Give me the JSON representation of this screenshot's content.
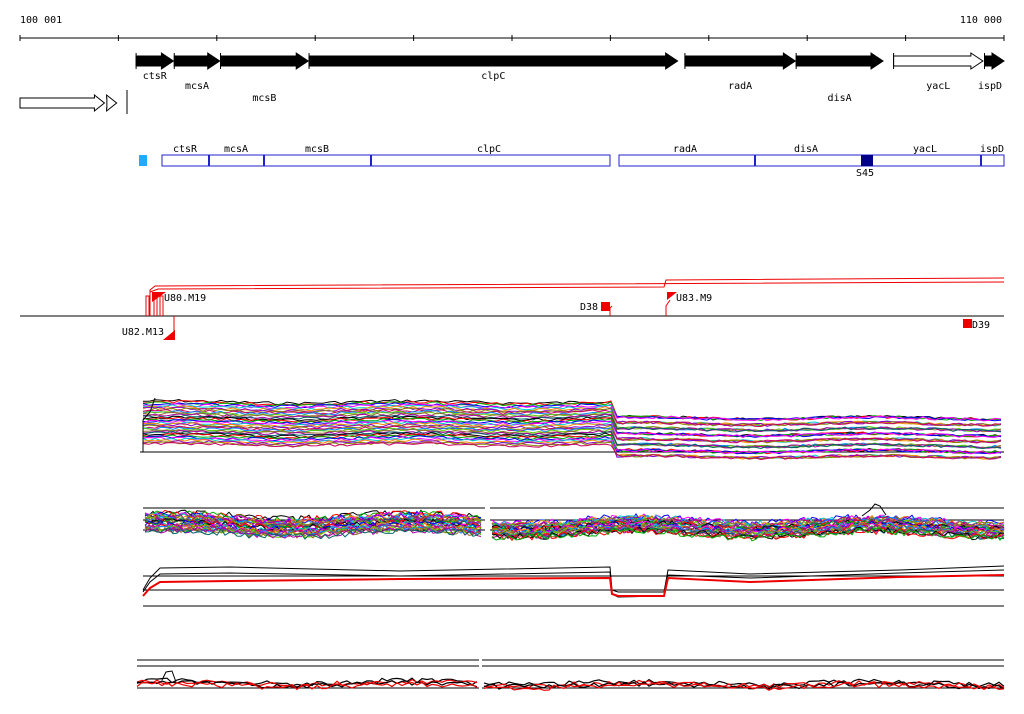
{
  "coordinates": {
    "start_label": "100 001",
    "end_label": "110 000",
    "start": 100001,
    "end": 110000
  },
  "genes": [
    {
      "name": "ctsR",
      "start": 101431,
      "end": 101891,
      "strand": "+",
      "filled": true,
      "label_row": 1
    },
    {
      "name": "mcsA",
      "start": 101901,
      "end": 102461,
      "strand": "+",
      "filled": true,
      "label_row": 2
    },
    {
      "name": "mcsB",
      "start": 102471,
      "end": 103551,
      "strand": "+",
      "filled": true,
      "label_row": 3
    },
    {
      "name": "clpC",
      "start": 103561,
      "end": 108101,
      "strand": "+",
      "filled": true,
      "label_row": 1
    },
    {
      "name": "radA",
      "start": 108191,
      "end": 109551,
      "strand": "+",
      "filled": true,
      "label_row": 2
    },
    {
      "name": "disA",
      "start": 109561,
      "end": 110631,
      "strand": "+",
      "filled": true,
      "label_row": 3
    },
    {
      "name": "yacL",
      "start": 110761,
      "end": 111861,
      "strand": "+",
      "filled": false,
      "label_row": 2
    },
    {
      "name": "ispD",
      "start": 111881,
      "end": 112121,
      "strand": "+",
      "filled": true,
      "label_row": 2
    }
  ],
  "upstream_features": [
    {
      "start": 100001,
      "end": 101041,
      "strand": "+",
      "filled": false
    },
    {
      "start": 101071,
      "end": 101191,
      "strand": "+",
      "filled": false
    }
  ],
  "operon_track": {
    "marker_color": "#22aaff",
    "box_color": "#2222cc",
    "segments": [
      {
        "name": "ctsR",
        "start": 101431,
        "end": 101891
      },
      {
        "name": "mcsA",
        "start": 101891,
        "end": 102461
      },
      {
        "name": "mcsB",
        "start": 102461,
        "end": 103551
      },
      {
        "name": "clpC",
        "start": 103551,
        "end": 108101
      },
      {
        "name": "radA",
        "start": 108191,
        "end": 109551
      },
      {
        "name": "disA",
        "start": 109551,
        "end": 111861
      },
      {
        "name": "yacL",
        "start": 111861,
        "end": 111861
      },
      {
        "name": "ispD",
        "start": 111861,
        "end": 112121
      }
    ],
    "highlight": {
      "label": "S45",
      "start": 110981,
      "end": 111101,
      "color": "#000088"
    }
  },
  "transcript_features": [
    {
      "label": "U80.M19",
      "position": 101331,
      "side": "above"
    },
    {
      "label": "U82.M13",
      "position": 101521,
      "side": "below"
    },
    {
      "label": "D38",
      "position": 108001,
      "side": "above"
    },
    {
      "label": "U83.M9",
      "position": 108571,
      "side": "above"
    },
    {
      "label": "D39",
      "position": 109881,
      "side": "below"
    }
  ],
  "colors": {
    "accent_red": "#ee0000",
    "gene_fill": "#000000",
    "dark_blue": "#000088"
  }
}
